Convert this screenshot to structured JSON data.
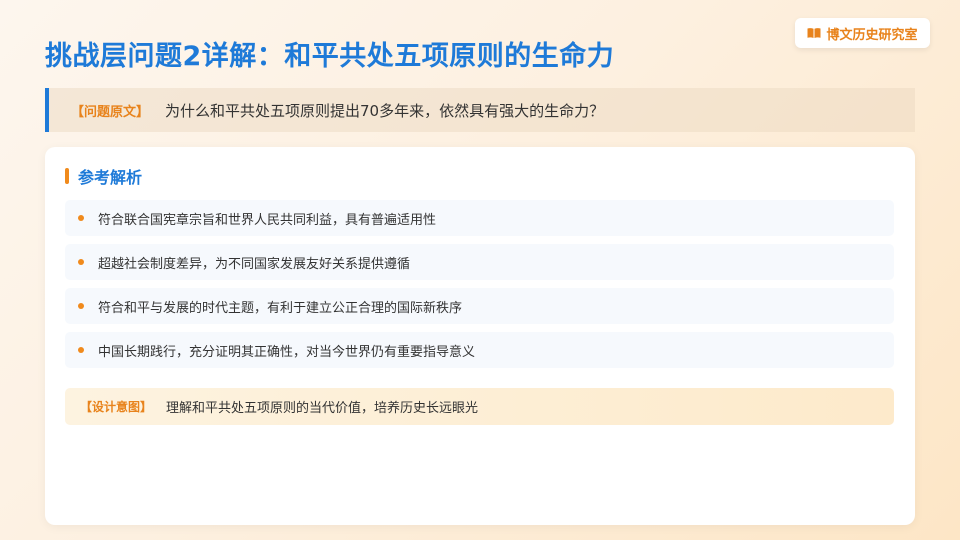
{
  "header": {
    "title": "挑战层问题2详解：和平共处五项原则的生命力",
    "brand": {
      "icon": "book-icon",
      "label": "博文历史研究室",
      "color": "#e8831c"
    }
  },
  "question": {
    "tag": "【问题原文】",
    "text": "为什么和平共处五项原则提出70多年来，依然具有强大的生命力？"
  },
  "analysis": {
    "title": "参考解析",
    "points": [
      "符合联合国宪章宗旨和世界人民共同利益，具有普遍适用性",
      "超越社会制度差异，为不同国家发展友好关系提供遵循",
      "符合和平与发展的时代主题，有利于建立公正合理的国际新秩序",
      "中国长期践行，充分证明其正确性，对当今世界仍有重要指导意义"
    ]
  },
  "design": {
    "tag": "【设计意图】",
    "text": "理解和平共处五项原则的当代价值，培养历史长远眼光"
  },
  "colors": {
    "title": "#1e7ad8",
    "accent": "#f08a1c",
    "tag": "#e8831c"
  }
}
